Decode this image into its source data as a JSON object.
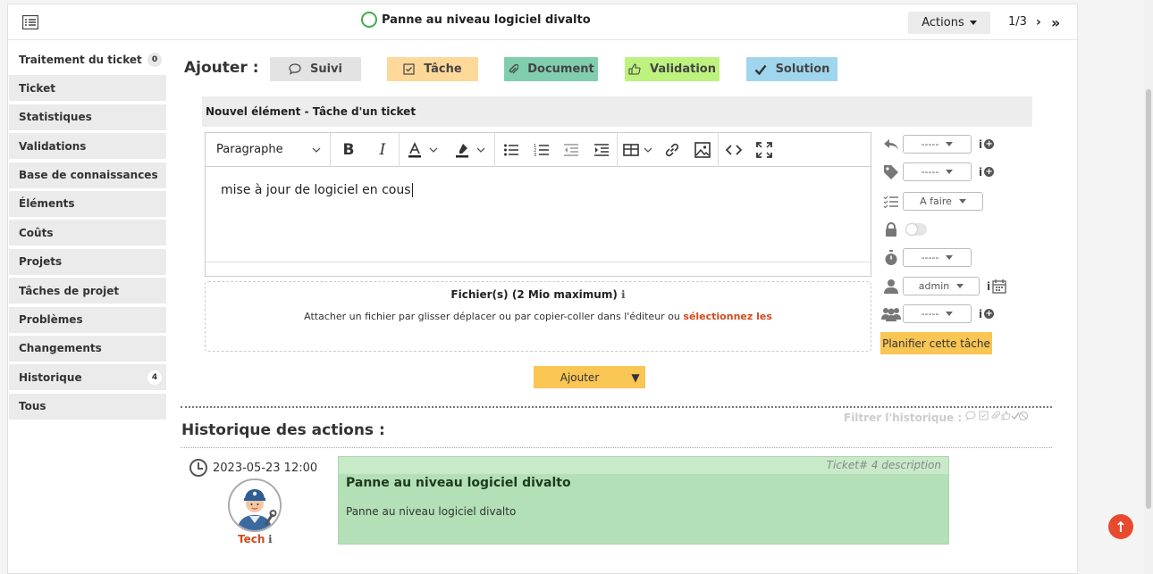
{
  "header": {
    "title": "Panne au niveau logiciel divalto",
    "actions_label": "Actions",
    "pager": "1/3"
  },
  "sidebar": {
    "items": [
      {
        "label": "Traitement du ticket",
        "badge": "0"
      },
      {
        "label": "Ticket"
      },
      {
        "label": "Statistiques"
      },
      {
        "label": "Validations"
      },
      {
        "label": "Base de connaissances"
      },
      {
        "label": "Éléments"
      },
      {
        "label": "Coûts"
      },
      {
        "label": "Projets"
      },
      {
        "label": "Tâches de projet"
      },
      {
        "label": "Problèmes"
      },
      {
        "label": "Changements"
      },
      {
        "label": "Historique",
        "badge": "4"
      },
      {
        "label": "Tous"
      }
    ]
  },
  "add_bar": {
    "label": "Ajouter :",
    "buttons": [
      {
        "label": "Suivi",
        "color": "#e3e3e3",
        "icon": "comment-icon"
      },
      {
        "label": "Tâche",
        "color": "#fed898",
        "icon": "check-square-icon"
      },
      {
        "label": "Document",
        "color": "#80cead",
        "icon": "paperclip-icon"
      },
      {
        "label": "Validation",
        "color": "#bef27e",
        "icon": "thumbs-up-icon"
      },
      {
        "label": "Solution",
        "color": "#9fd6ed",
        "icon": "check-icon"
      }
    ]
  },
  "panel": {
    "title": "Nouvel élément - Tâche d'un ticket"
  },
  "editor": {
    "paragraph_label": "Paragraphe",
    "content": "mise à jour de logiciel en cous"
  },
  "dropzone": {
    "title": "Fichier(s) (2 Mio maximum)",
    "text": "Attacher un fichier par glisser déplacer ou par copier-coller dans l'éditeur ou ",
    "link": "sélectionnez les"
  },
  "task_fields": {
    "template": "-----",
    "category": "-----",
    "status": "A faire",
    "duration": "-----",
    "user": "admin",
    "group": "-----",
    "plan_button": "Planifier cette tâche"
  },
  "submit": {
    "label": "Ajouter"
  },
  "history": {
    "filter_label": "Filtrer l'historique :",
    "title": "Historique des actions :",
    "entry": {
      "date": "2023-05-23 12:00",
      "user": "Tech",
      "meta": "Ticket# 4 description",
      "title": "Panne au niveau logiciel divalto",
      "body": "Panne au niveau logiciel divalto"
    }
  }
}
